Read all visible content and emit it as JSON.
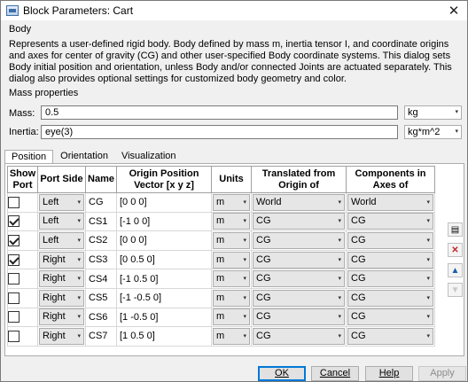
{
  "window": {
    "title": "Block Parameters: Cart",
    "close_glyph": "✕"
  },
  "body_section": {
    "title": "Body",
    "description": "Represents a user-defined rigid body. Body defined by mass m, inertia tensor I, and coordinate origins and axes for center of gravity (CG) and other user-specified Body coordinate systems. This dialog sets Body initial position and orientation, unless Body and/or connected Joints are actuated separately. This dialog also provides optional settings for customized body geometry and color."
  },
  "mass_properties": {
    "title": "Mass properties",
    "mass": {
      "label": "Mass:",
      "value": "0.5",
      "unit": "kg"
    },
    "inertia": {
      "label": "Inertia:",
      "value": "eye(3)",
      "unit": "kg*m^2"
    }
  },
  "tabs": [
    "Position",
    "Orientation",
    "Visualization"
  ],
  "table": {
    "headers": {
      "show_port": "Show Port",
      "port_side": "Port Side",
      "name": "Name",
      "origin": "Origin Position Vector [x y z]",
      "units": "Units",
      "translated": "Translated from Origin of",
      "components": "Components in Axes of"
    },
    "rows": [
      {
        "show": false,
        "side": "Left",
        "name": "CG",
        "origin": "[0 0 0]",
        "units": "m",
        "translated": "World",
        "components": "World"
      },
      {
        "show": true,
        "side": "Left",
        "name": "CS1",
        "origin": "[-1 0 0]",
        "units": "m",
        "translated": "CG",
        "components": "CG"
      },
      {
        "show": true,
        "side": "Left",
        "name": "CS2",
        "origin": "[0 0 0]",
        "units": "m",
        "translated": "CG",
        "components": "CG"
      },
      {
        "show": true,
        "side": "Right",
        "name": "CS3",
        "origin": "[0 0.5 0]",
        "units": "m",
        "translated": "CG",
        "components": "CG"
      },
      {
        "show": false,
        "side": "Right",
        "name": "CS4",
        "origin": "[-1 0.5 0]",
        "units": "m",
        "translated": "CG",
        "components": "CG"
      },
      {
        "show": false,
        "side": "Right",
        "name": "CS5",
        "origin": "[-1 -0.5 0]",
        "units": "m",
        "translated": "CG",
        "components": "CG"
      },
      {
        "show": false,
        "side": "Right",
        "name": "CS6",
        "origin": "[1 -0.5 0]",
        "units": "m",
        "translated": "CG",
        "components": "CG"
      },
      {
        "show": false,
        "side": "Right",
        "name": "CS7",
        "origin": "[1 0.5 0]",
        "units": "m",
        "translated": "CG",
        "components": "CG"
      }
    ]
  },
  "side_buttons": [
    {
      "name": "add-row-button",
      "glyph": "▤"
    },
    {
      "name": "delete-row-button",
      "glyph": "✕"
    },
    {
      "name": "move-up-button",
      "glyph": "▲"
    },
    {
      "name": "move-down-button",
      "glyph": "▼"
    }
  ],
  "buttons": {
    "ok": "OK",
    "cancel": "Cancel",
    "help": "Help",
    "apply": "Apply"
  },
  "dropdown_arrow": "▾"
}
